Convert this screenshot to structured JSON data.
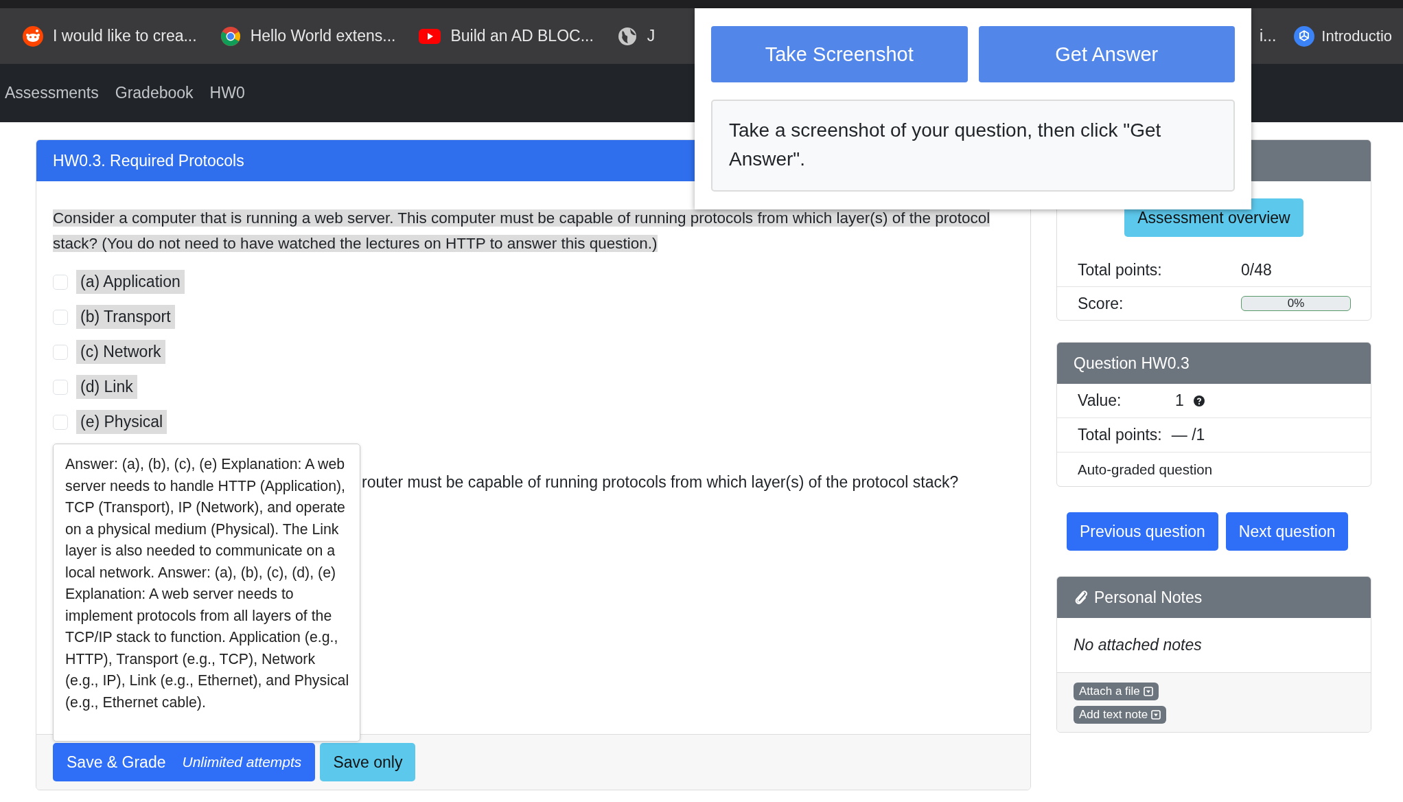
{
  "browser_tabs": [
    {
      "title": "I would like to crea..."
    },
    {
      "title": "Hello World extens..."
    },
    {
      "title": "Build an AD BLOC..."
    },
    {
      "title": "J"
    },
    {
      "title": "i..."
    },
    {
      "title": "Introductio"
    }
  ],
  "nav": {
    "links": [
      "Assessments",
      "Gradebook",
      "HW0"
    ]
  },
  "question_card": {
    "title": "HW0.3. Required Protocols",
    "question": "Consider a computer that is running a web server. This computer must be capable of running protocols from which layer(s) of the protocol stack? (You do not need to have watched the lectures on HTTP to answer this question.)",
    "options": [
      {
        "label": "(a) Application",
        "checked": false
      },
      {
        "label": "(b) Transport",
        "checked": false
      },
      {
        "label": "(c) Network",
        "checked": false
      },
      {
        "label": "(d) Link",
        "checked": false
      },
      {
        "label": "(e) Physical",
        "checked": false
      }
    ],
    "second_question_visible": "router must be capable of running protocols from which layer(s) of the protocol stack?",
    "save_grade_button": {
      "label": "Save & Grade",
      "note": "Unlimited attempts"
    },
    "save_only_button": "Save only"
  },
  "assessment_card": {
    "overview_button": "Assessment overview",
    "total_points_label": "Total points:",
    "total_points": "0/48",
    "score_label": "Score:",
    "score": {
      "level": 0,
      "reading": "0%"
    }
  },
  "question_info": {
    "title": "Question HW0.3",
    "rows": [
      {
        "kind": "value",
        "label": "Value:",
        "value": "1"
      },
      {
        "kind": "points",
        "label": "Total points:",
        "value": "— /1"
      },
      {
        "kind": "note",
        "label": "Auto-graded question"
      }
    ]
  },
  "nav_buttons": [
    "Previous question",
    "Next question"
  ],
  "notes_card": {
    "title": "Personal Notes",
    "empty_text": "No attached notes",
    "actions": [
      "Attach a file",
      "Add text note"
    ]
  },
  "popup": {
    "buttons": [
      "Take Screenshot",
      "Get Answer"
    ],
    "message": "Take a screenshot of your question, then click \"Get Answer\"."
  },
  "tooltip": {
    "text": "Answer: (a), (b), (c), (e) Explanation: A web server needs to handle HTTP (Application), TCP (Transport), IP (Network), and operate on a physical medium (Physical). The Link layer is also needed to communicate on a local network. Answer: (a), (b), (c), (d), (e) Explanation: A web server needs to implement protocols from all layers of the TCP/IP stack to function. Application (e.g., HTTP), Transport (e.g., TCP), Network (e.g., IP), Link (e.g., Ethernet), and Physical (e.g., Ethernet cable)."
  }
}
